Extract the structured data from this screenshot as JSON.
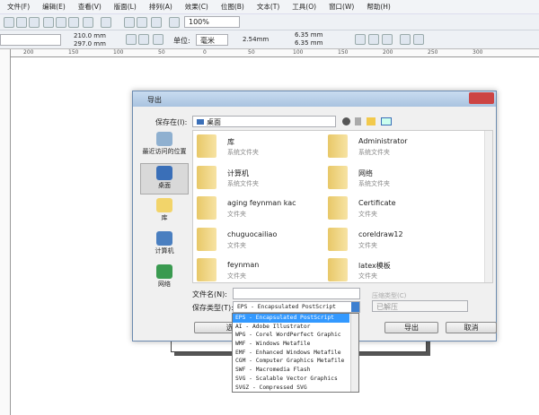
{
  "menu": [
    "文件(F)",
    "编辑(E)",
    "查看(V)",
    "版面(L)",
    "排列(A)",
    "效果(C)",
    "位图(B)",
    "文本(T)",
    "工具(O)",
    "窗口(W)",
    "帮助(H)"
  ],
  "toolbar": {
    "zoom": "100%"
  },
  "propbar": {
    "width": "210.0 mm",
    "height": "297.0 mm",
    "unit_label": "单位:",
    "unit": "毫米",
    "nudge": "2.54mm",
    "dup_x": "6.35 mm",
    "dup_y": "6.35 mm"
  },
  "ruler": [
    "200",
    "150",
    "100",
    "50",
    "0",
    "50",
    "100",
    "150",
    "200",
    "250",
    "300"
  ],
  "dialog": {
    "title": "导出",
    "save_in_label": "保存在(I):",
    "save_in_value": "桌面",
    "places": [
      {
        "label": "最近访问的位置"
      },
      {
        "label": "桌面"
      },
      {
        "label": "库"
      },
      {
        "label": "计算机"
      },
      {
        "label": "网络"
      }
    ],
    "files": [
      {
        "name": "库",
        "type": "系统文件夹"
      },
      {
        "name": "Administrator",
        "type": "系统文件夹"
      },
      {
        "name": "计算机",
        "type": "系统文件夹"
      },
      {
        "name": "网络",
        "type": "系统文件夹"
      },
      {
        "name": "aging feynman kac",
        "type": "文件夹"
      },
      {
        "name": "Certificate",
        "type": "文件夹"
      },
      {
        "name": "chuguocailiao",
        "type": "文件夹"
      },
      {
        "name": "coreldraw12",
        "type": "文件夹"
      },
      {
        "name": "feynman",
        "type": "文件夹"
      },
      {
        "name": "latex模板",
        "type": "文件夹"
      }
    ],
    "filename_label": "文件名(N):",
    "filename_value": "",
    "savetype_label": "保存类型(T):",
    "savetype_value": "EPS - Encapsulated PostScript",
    "compress_label": "压缩类型(C)",
    "compress_value": "已解压",
    "options_button": "选项>>",
    "export_button": "导出",
    "cancel_button": "取消",
    "type_options": [
      "EPS - Encapsulated PostScript",
      "AI - Adobe Illustrator",
      "WPG - Corel WordPerfect Graphic",
      "WMF - Windows Metafile",
      "EMF - Enhanced Windows Metafile",
      "CGM - Computer Graphics Metafile",
      "SWF - Macromedia Flash",
      "SVG - Scalable Vector Graphics",
      "SVGZ - Compressed SVG"
    ]
  },
  "colors": {
    "selection": "#3399ff",
    "titlebar": "#b9d1ea"
  }
}
